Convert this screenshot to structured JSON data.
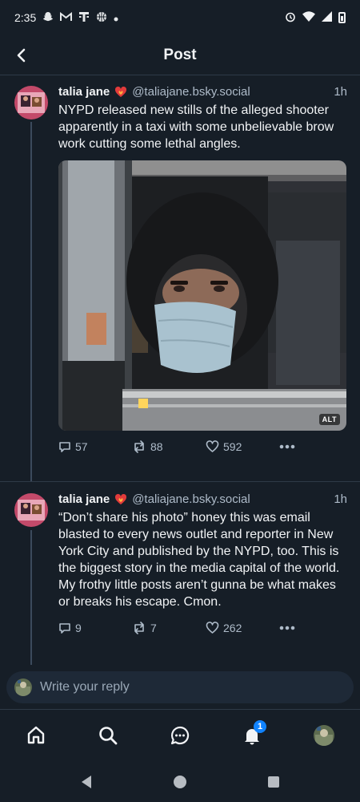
{
  "status_bar": {
    "time": "2:35",
    "icons_left": [
      "snapchat-icon",
      "gmail-icon",
      "tmobile-icon",
      "basketball-icon",
      "dot-icon"
    ],
    "icons_right": [
      "alarm-icon",
      "wifi-icon",
      "signal-icon",
      "battery-icon"
    ]
  },
  "header": {
    "title": "Post",
    "back_icon": "chevron-left-icon"
  },
  "posts": [
    {
      "author": "talia jane",
      "handle": "@taliajane.bsky.social",
      "time": "1h",
      "text": "NYPD released new stills of the alleged shooter apparently in a taxi with some unbelievable brow work cutting some lethal angles.",
      "image_alt_badge": "ALT",
      "replies": "57",
      "reposts": "88",
      "likes": "592"
    },
    {
      "author": "talia jane",
      "handle": "@taliajane.bsky.social",
      "time": "1h",
      "text": "“Don’t share his photo” honey this was email blasted to every news outlet and reporter in New York City and published by the NYPD, too. This is the biggest story in the media capital of the world. My frothy little posts aren’t gunna be what makes or breaks his escape. Cmon.",
      "replies": "9",
      "reposts": "7",
      "likes": "262"
    }
  ],
  "reply_bar": {
    "placeholder": "Write your reply"
  },
  "bottom_nav": {
    "items": [
      "home-icon",
      "search-icon",
      "chat-icon",
      "notifications-icon",
      "profile-avatar"
    ],
    "notification_count": "1"
  },
  "colors": {
    "background": "#161e27",
    "accent": "#1083fe",
    "muted": "#aebbc9"
  }
}
